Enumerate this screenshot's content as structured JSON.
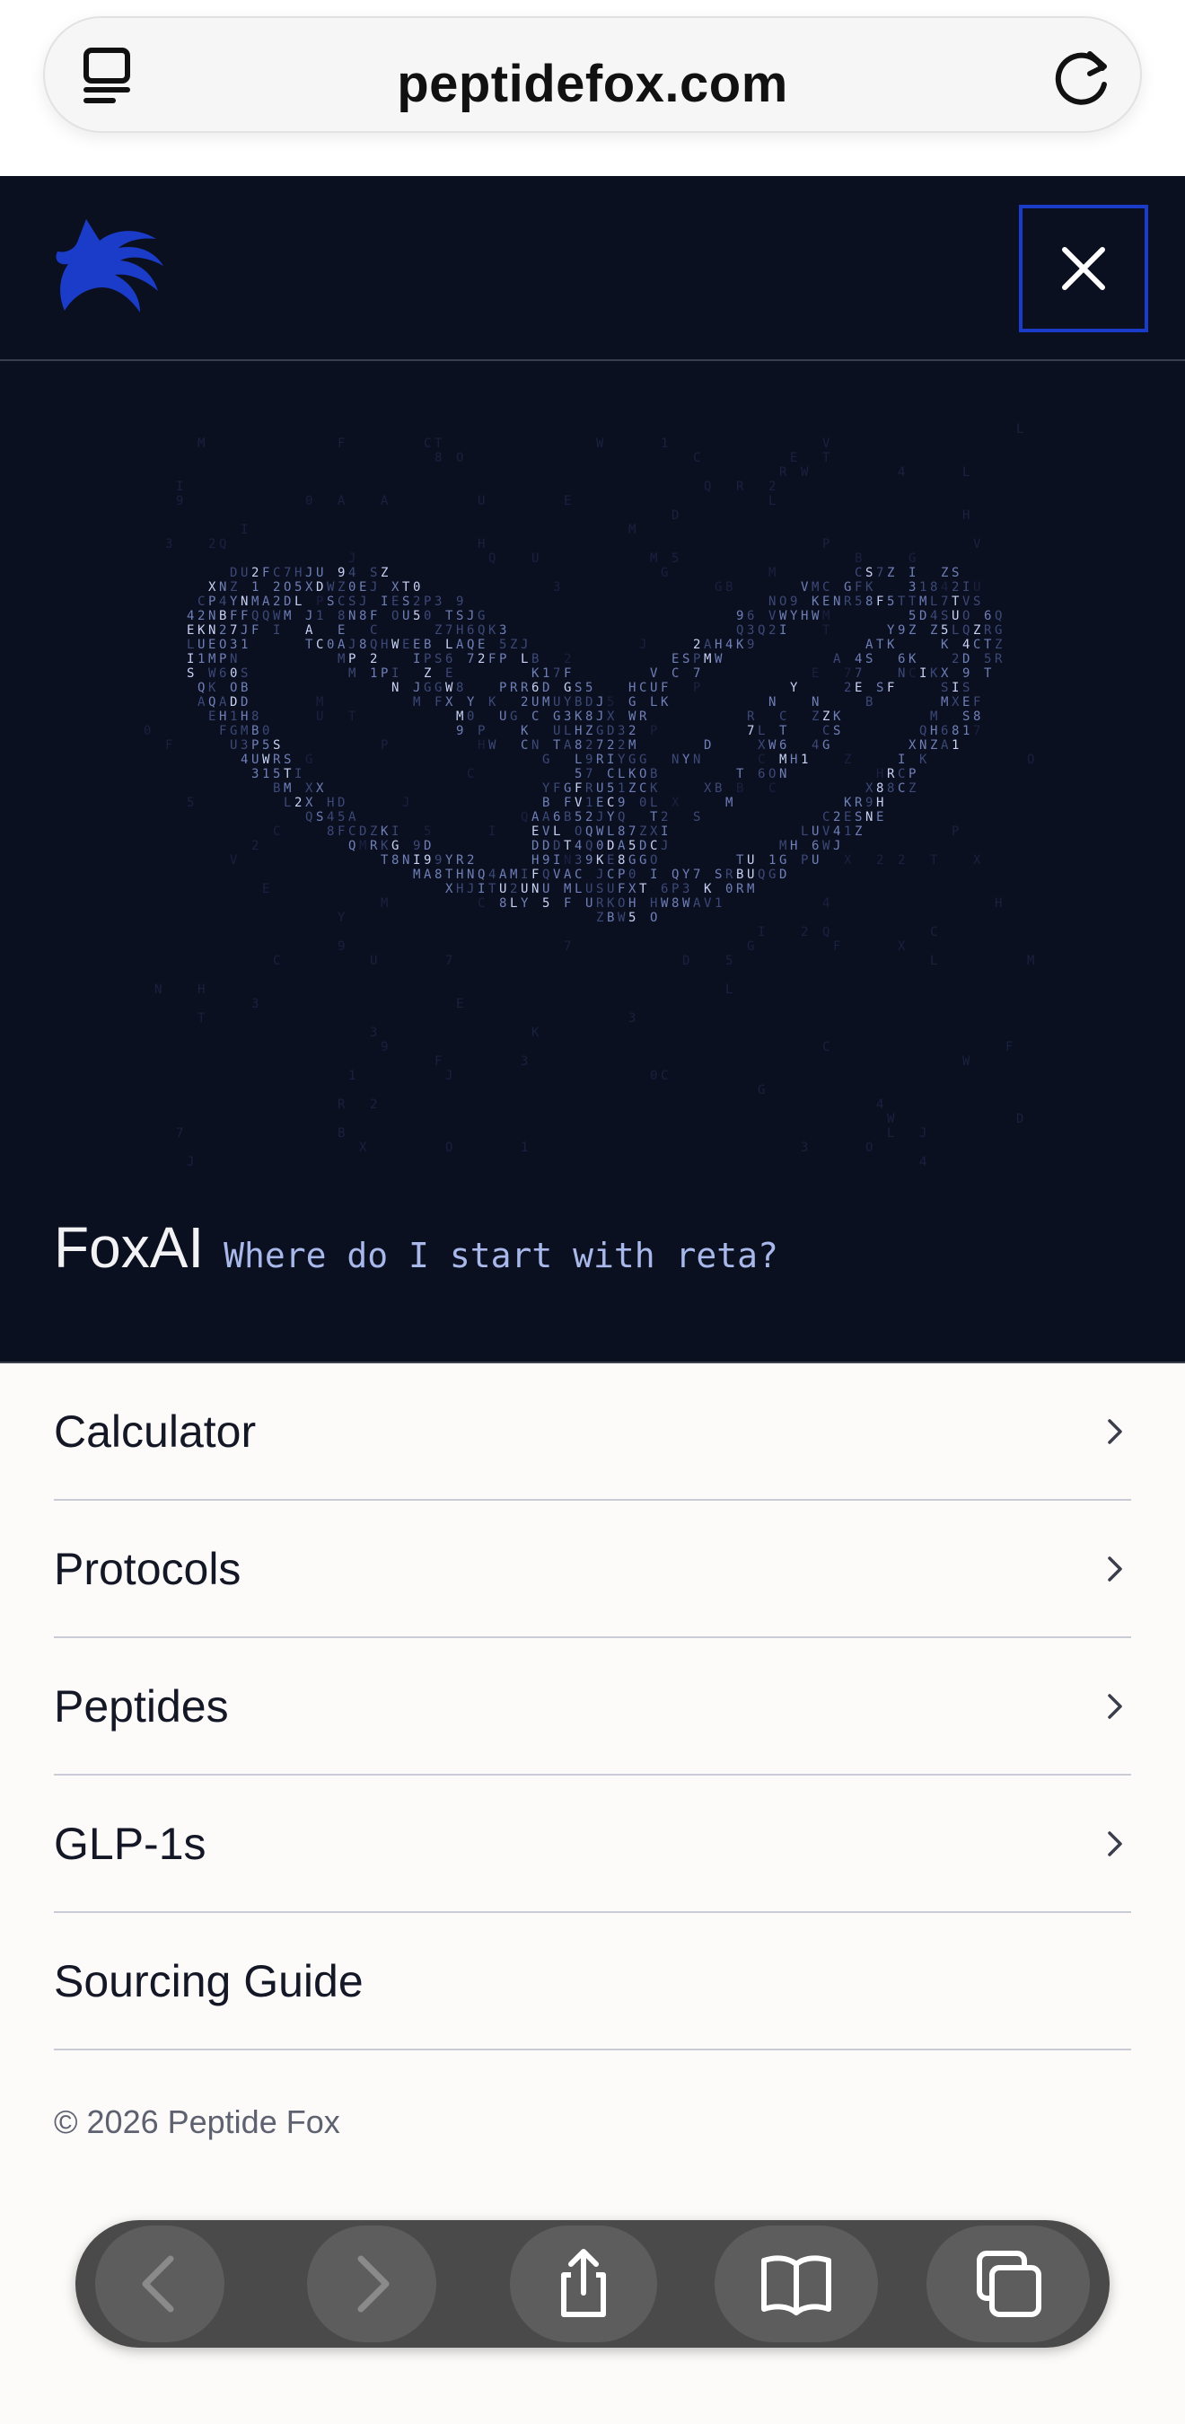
{
  "browser": {
    "domain": "peptidefox.com",
    "tab_icon": "tabs-icon",
    "reload_icon": "reload-icon"
  },
  "header": {
    "logo": "fox-logo",
    "close_icon": "close-icon",
    "accent_color": "#1b3cc9",
    "background_color": "#0b1020"
  },
  "hero": {
    "title": "FoxAI",
    "prompt": "Where do I start with reta?",
    "art": "ascii-pill-capsule"
  },
  "menu": {
    "items": [
      {
        "label": "Calculator",
        "has_chevron": true
      },
      {
        "label": "Protocols",
        "has_chevron": true
      },
      {
        "label": "Peptides",
        "has_chevron": true
      },
      {
        "label": "GLP-1s",
        "has_chevron": true
      },
      {
        "label": "Sourcing Guide",
        "has_chevron": false
      }
    ],
    "copyright": "© 2026 Peptide Fox"
  },
  "toolbar": {
    "buttons": [
      "back-icon",
      "forward-icon",
      "share-icon",
      "bookmarks-icon",
      "tabs-icon"
    ]
  }
}
